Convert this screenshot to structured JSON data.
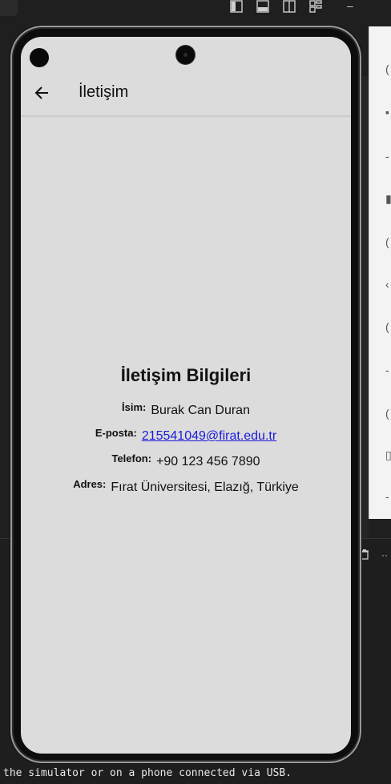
{
  "ide": {
    "terminal_text": "the simulator or on a phone connected via USB.",
    "minimize_glyph": "–",
    "more_glyph": "··"
  },
  "app": {
    "title": "İletişim",
    "section_title": "İletişim Bilgileri",
    "rows": [
      {
        "label": "İsim:",
        "value": "Burak Can Duran",
        "link": false
      },
      {
        "label": "E-posta:",
        "value": "215541049@firat.edu.tr",
        "link": true
      },
      {
        "label": "Telefon:",
        "value": "+90 123 456 7890",
        "link": false
      },
      {
        "label": "Adres:",
        "value": "Fırat Üniversitesi, Elazığ, Türkiye",
        "link": false
      }
    ]
  },
  "colors": {
    "screen_bg": "#dcdcdc",
    "link": "#1a1adc",
    "ide_bg": "#1f1f1f"
  },
  "icons": {
    "back": "arrow-left-icon",
    "layout": [
      "sidebar-left-icon",
      "panel-bottom-icon",
      "split-vertical-icon",
      "layout-grid-icon"
    ],
    "trash": "trash-icon"
  }
}
